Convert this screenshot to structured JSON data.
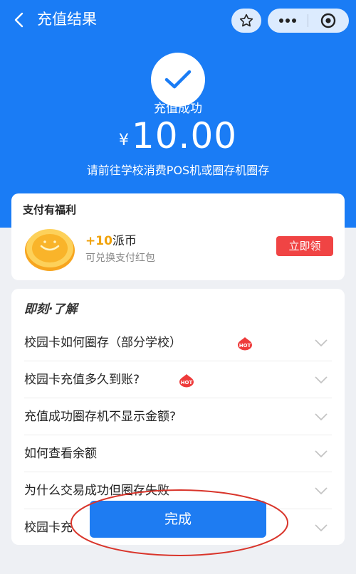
{
  "nav": {
    "title": "充值结果"
  },
  "result": {
    "status": "充值成功",
    "currency": "¥",
    "amount": "10.00",
    "hint": "请前往学校消费POS机或圈存机圈存"
  },
  "benefit": {
    "title": "支付有福利",
    "reward_plus": "+10",
    "reward_unit": "派币",
    "reward_desc": "可兑换支付红包",
    "claim_label": "立即领"
  },
  "faq": {
    "header": "即刻·了解",
    "hot_label": "HOT",
    "items": [
      {
        "question": "校园卡如何圈存（部分学校）",
        "hot": true
      },
      {
        "question": "校园卡充值多久到账?",
        "hot": true
      },
      {
        "question": "充值成功圈存机不显示金额?",
        "hot": false
      },
      {
        "question": "如何查看余额",
        "hot": false
      },
      {
        "question": "为什么交易成功但圈存失败",
        "hot": false
      },
      {
        "question": "校园卡充",
        "hot": false
      }
    ]
  },
  "footer": {
    "done_label": "完成"
  },
  "colors": {
    "brand_blue": "#1a7cf5",
    "claim_red": "#f04444",
    "annotation_red": "#d9352b"
  }
}
